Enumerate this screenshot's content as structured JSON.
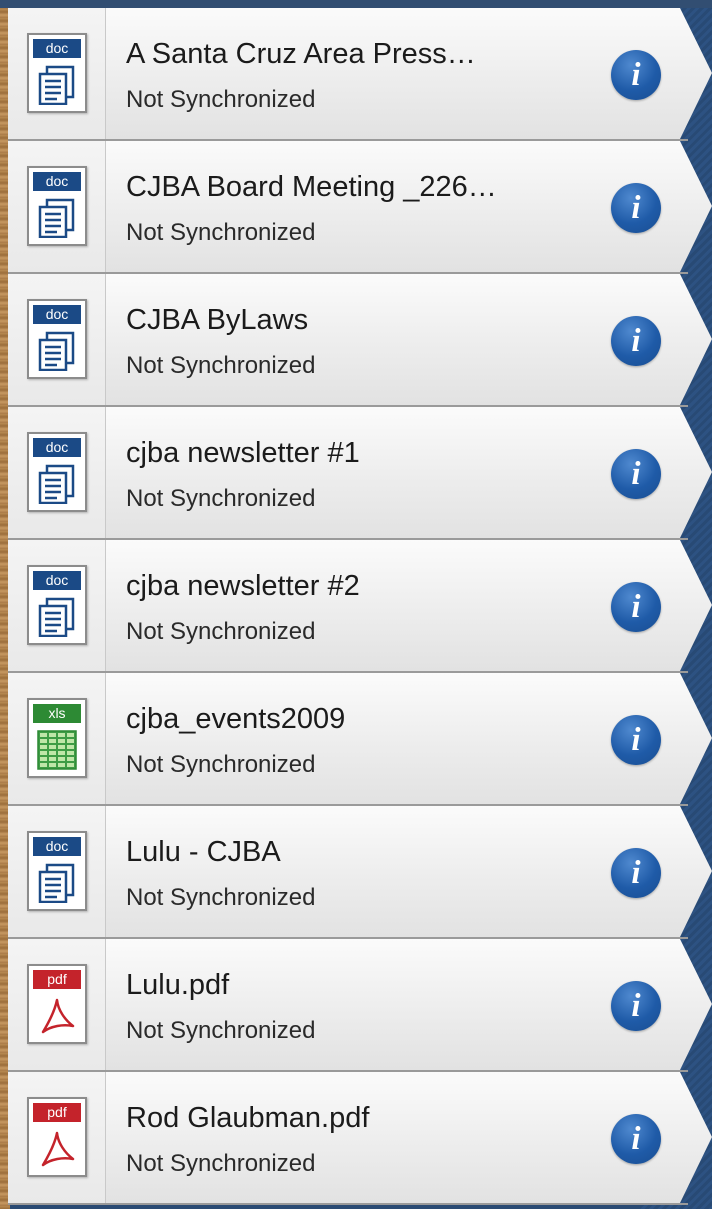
{
  "files": [
    {
      "name": "A Santa Cruz Area Press…",
      "status": "Not Synchronized",
      "type": "doc"
    },
    {
      "name": "CJBA Board Meeting _226…",
      "status": "Not Synchronized",
      "type": "doc"
    },
    {
      "name": "CJBA ByLaws",
      "status": "Not Synchronized",
      "type": "doc"
    },
    {
      "name": "cjba newsletter #1",
      "status": "Not Synchronized",
      "type": "doc"
    },
    {
      "name": "cjba newsletter #2",
      "status": "Not Synchronized",
      "type": "doc"
    },
    {
      "name": "cjba_events2009",
      "status": "Not Synchronized",
      "type": "xls"
    },
    {
      "name": "Lulu - CJBA",
      "status": "Not Synchronized",
      "type": "doc"
    },
    {
      "name": "Lulu.pdf",
      "status": "Not Synchronized",
      "type": "pdf"
    },
    {
      "name": "Rod Glaubman.pdf",
      "status": "Not Synchronized",
      "type": "pdf"
    }
  ],
  "info_glyph": "i",
  "colors": {
    "doc_tag": "#1b4a86",
    "xls_tag": "#2d8a34",
    "pdf_tag": "#c4232b",
    "info_button": "#1f5ba8",
    "backdrop": "#2a4a73"
  }
}
